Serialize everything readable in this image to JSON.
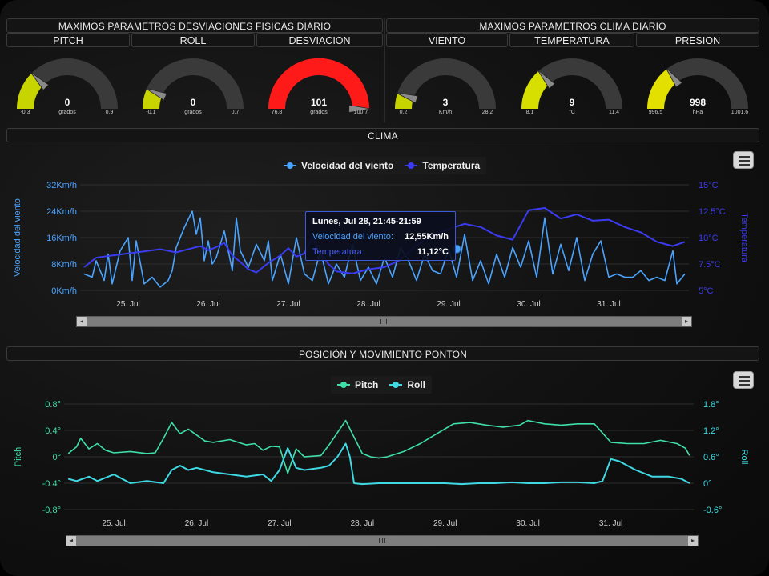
{
  "header": {
    "left_title": "MAXIMOS PARAMETROS DESVIACIONES FISICAS DIARIO",
    "right_title": "MAXIMOS PARAMETROS CLIMA DIARIO"
  },
  "gauges": [
    {
      "id": "pitch",
      "label": "PITCH",
      "value": "0",
      "unit": "grados",
      "min": "-0.3",
      "max": "0.9",
      "fill": 0.25,
      "color": "#c8d400"
    },
    {
      "id": "roll",
      "label": "ROLL",
      "value": "0",
      "unit": "grados",
      "min": "-0.1",
      "max": "0.7",
      "fill": 0.13,
      "color": "#c8d400"
    },
    {
      "id": "desviacion",
      "label": "DESVIACION",
      "value": "101",
      "unit": "grados",
      "min": "76.8",
      "max": "100.7",
      "fill": 1.0,
      "color": "#ff1a1a"
    },
    {
      "id": "viento",
      "label": "VIENTO",
      "value": "3",
      "unit": "Km/h",
      "min": "0.2",
      "max": "28.2",
      "fill": 0.1,
      "color": "#c8d400"
    },
    {
      "id": "temperatura",
      "label": "TEMPERATURA",
      "value": "9",
      "unit": "°C",
      "min": "8.1",
      "max": "11.4",
      "fill": 0.27,
      "color": "#d6df00"
    },
    {
      "id": "presion",
      "label": "PRESION",
      "value": "998",
      "unit": "hPa",
      "min": "996.5",
      "max": "1001.6",
      "fill": 0.29,
      "color": "#e3e000"
    }
  ],
  "clima": {
    "title": "CLIMA",
    "legend": [
      {
        "name": "Velocidad del viento",
        "color": "#4aa3ff"
      },
      {
        "name": "Temperatura",
        "color": "#3b3bf2"
      }
    ],
    "tooltip": {
      "header": "Lunes, Jul 28, 21:45-21:59",
      "row1_label": "Velocidad del viento:",
      "row1_value": "12,55Km/h",
      "row2_label": "Temperatura:",
      "row2_value": "11,12°C"
    },
    "menu_icon": "hamburger-icon"
  },
  "ponton": {
    "title": "POSICIÓN Y MOVIMIENTO PONTON",
    "legend": [
      {
        "name": "Pitch",
        "color": "#3ee0a8"
      },
      {
        "name": "Roll",
        "color": "#3fd9e4"
      }
    ],
    "menu_icon": "hamburger-icon"
  },
  "chart_data": [
    {
      "type": "line",
      "title": "CLIMA",
      "xlabel": "",
      "x_ticks": [
        "25. Jul",
        "26. Jul",
        "27. Jul",
        "28. Jul",
        "29. Jul",
        "30. Jul",
        "31. Jul"
      ],
      "y_left": {
        "label": "Velocidad del viento",
        "ticks": [
          "0Km/h",
          "8Km/h",
          "16Km/h",
          "24Km/h",
          "32Km/h"
        ],
        "range": [
          0,
          32
        ]
      },
      "y_right": {
        "label": "Temperatura",
        "ticks": [
          "5°C",
          "7.5°C",
          "10°C",
          "12.5°C",
          "15°C"
        ],
        "range": [
          5,
          15
        ]
      },
      "x_range": [
        -0.6,
        7.0
      ],
      "series": [
        {
          "name": "Velocidad del viento",
          "axis": "left",
          "color": "#4aa3ff",
          "x": [
            -0.55,
            -0.45,
            -0.4,
            -0.3,
            -0.25,
            -0.2,
            -0.1,
            0.0,
            0.05,
            0.1,
            0.2,
            0.3,
            0.4,
            0.5,
            0.55,
            0.6,
            0.7,
            0.8,
            0.85,
            0.9,
            0.95,
            1.0,
            1.05,
            1.1,
            1.2,
            1.3,
            1.35,
            1.4,
            1.5,
            1.6,
            1.7,
            1.75,
            1.8,
            1.9,
            2.0,
            2.1,
            2.2,
            2.3,
            2.4,
            2.5,
            2.6,
            2.7,
            2.8,
            2.9,
            3.0,
            3.1,
            3.2,
            3.3,
            3.4,
            3.5,
            3.6,
            3.7,
            3.8,
            3.9,
            4.0,
            4.1,
            4.2,
            4.3,
            4.4,
            4.5,
            4.6,
            4.7,
            4.8,
            4.9,
            5.0,
            5.1,
            5.2,
            5.3,
            5.4,
            5.5,
            5.6,
            5.7,
            5.8,
            5.9,
            6.0,
            6.1,
            6.2,
            6.3,
            6.4,
            6.5,
            6.6,
            6.7,
            6.8,
            6.85,
            6.95
          ],
          "values": [
            5,
            4,
            9,
            3,
            11,
            2,
            12,
            16,
            3,
            15,
            2,
            4,
            1,
            3,
            6,
            13,
            19,
            24,
            17,
            22,
            9,
            15,
            8,
            10,
            18,
            6,
            22,
            12,
            7,
            14,
            9,
            15,
            3,
            11,
            2,
            16,
            5,
            3,
            12,
            2,
            8,
            4,
            14,
            3,
            7,
            2,
            10,
            4,
            13,
            9,
            3,
            11,
            6,
            5,
            12.5,
            4,
            17,
            3,
            9,
            2,
            11,
            4,
            13,
            7,
            15,
            4,
            22,
            5,
            14,
            6,
            16,
            3,
            11,
            15,
            4,
            5,
            4,
            4,
            6,
            3,
            4,
            3,
            12,
            2,
            5
          ]
        },
        {
          "name": "Temperatura",
          "axis": "right",
          "color": "#3b3bf2",
          "x": [
            -0.55,
            -0.4,
            -0.2,
            0.0,
            0.2,
            0.4,
            0.6,
            0.8,
            0.9,
            1.0,
            1.1,
            1.2,
            1.3,
            1.4,
            1.5,
            1.6,
            1.75,
            1.9,
            2.0,
            2.1,
            2.2,
            2.3,
            2.4,
            2.5,
            2.6,
            2.8,
            3.0,
            3.2,
            3.4,
            3.5,
            3.6,
            3.8,
            4.0,
            4.2,
            4.4,
            4.6,
            4.8,
            5.0,
            5.2,
            5.4,
            5.6,
            5.8,
            6.0,
            6.2,
            6.4,
            6.6,
            6.8,
            6.95
          ],
          "values": [
            7.2,
            8.1,
            8.3,
            8.5,
            8.7,
            8.9,
            8.6,
            9.0,
            9.2,
            8.8,
            9.1,
            9.5,
            8.3,
            7.7,
            7.0,
            6.7,
            7.6,
            8.3,
            9.0,
            8.2,
            8.5,
            10.0,
            8.6,
            7.5,
            6.8,
            6.6,
            7.0,
            7.2,
            7.9,
            8.6,
            9.3,
            10.2,
            10.8,
            11.3,
            11.0,
            10.2,
            9.8,
            12.6,
            12.8,
            11.8,
            12.2,
            11.6,
            11.7,
            11.0,
            10.5,
            9.6,
            9.2,
            9.6
          ]
        }
      ]
    },
    {
      "type": "line",
      "title": "POSICIÓN Y MOVIMIENTO PONTON",
      "xlabel": "",
      "x_ticks": [
        "25. Jul",
        "26. Jul",
        "27. Jul",
        "28. Jul",
        "29. Jul",
        "30. Jul",
        "31. Jul"
      ],
      "y_left": {
        "label": "Pitch",
        "ticks": [
          "-0.8°",
          "-0.4°",
          "0°",
          "0.4°",
          "0.8°"
        ],
        "range": [
          -0.8,
          0.8
        ]
      },
      "y_right": {
        "label": "Roll",
        "ticks": [
          "-0.6°",
          "0°",
          "0.6°",
          "1.2°",
          "1.8°"
        ],
        "range": [
          -0.6,
          1.8
        ]
      },
      "x_range": [
        -0.6,
        7.0
      ],
      "series": [
        {
          "name": "Pitch",
          "axis": "left",
          "color": "#3ee0a8",
          "x": [
            -0.55,
            -0.45,
            -0.4,
            -0.3,
            -0.2,
            -0.1,
            0.0,
            0.2,
            0.4,
            0.5,
            0.6,
            0.7,
            0.8,
            0.9,
            1.0,
            1.1,
            1.2,
            1.4,
            1.6,
            1.7,
            1.8,
            1.9,
            2.0,
            2.1,
            2.2,
            2.3,
            2.5,
            2.6,
            2.8,
            3.0,
            3.1,
            3.2,
            3.3,
            3.5,
            3.7,
            3.9,
            4.1,
            4.3,
            4.5,
            4.7,
            4.9,
            5.0,
            5.2,
            5.4,
            5.6,
            5.8,
            6.0,
            6.2,
            6.4,
            6.6,
            6.8,
            6.9,
            6.95
          ],
          "values": [
            0.05,
            0.15,
            0.28,
            0.12,
            0.2,
            0.1,
            0.06,
            0.08,
            0.05,
            0.06,
            0.28,
            0.52,
            0.35,
            0.42,
            0.33,
            0.24,
            0.22,
            0.26,
            0.18,
            0.2,
            0.1,
            0.16,
            0.15,
            -0.25,
            0.12,
            0.0,
            0.02,
            0.18,
            0.55,
            0.05,
            0.0,
            -0.02,
            0.0,
            0.08,
            0.2,
            0.35,
            0.5,
            0.52,
            0.48,
            0.45,
            0.48,
            0.55,
            0.5,
            0.48,
            0.5,
            0.5,
            0.22,
            0.2,
            0.2,
            0.25,
            0.2,
            0.13,
            0.02
          ]
        },
        {
          "name": "Roll",
          "axis": "right",
          "color": "#3fd9e4",
          "x": [
            -0.55,
            -0.45,
            -0.3,
            -0.2,
            0.0,
            0.2,
            0.4,
            0.6,
            0.7,
            0.8,
            0.9,
            1.0,
            1.1,
            1.2,
            1.4,
            1.6,
            1.8,
            1.9,
            2.0,
            2.1,
            2.2,
            2.3,
            2.5,
            2.6,
            2.7,
            2.8,
            2.85,
            2.9,
            3.0,
            3.2,
            3.4,
            3.6,
            3.8,
            4.0,
            4.2,
            4.4,
            4.6,
            4.8,
            5.0,
            5.2,
            5.4,
            5.6,
            5.8,
            5.9,
            6.0,
            6.1,
            6.3,
            6.5,
            6.7,
            6.85,
            6.95
          ],
          "values": [
            0.1,
            0.05,
            0.15,
            0.05,
            0.2,
            0.0,
            0.05,
            0.0,
            0.3,
            0.4,
            0.3,
            0.35,
            0.3,
            0.25,
            0.2,
            0.15,
            0.2,
            0.05,
            0.3,
            0.8,
            0.35,
            0.3,
            0.35,
            0.4,
            0.6,
            0.9,
            0.6,
            0.0,
            -0.02,
            0.0,
            0.0,
            0.0,
            0.0,
            0.0,
            -0.02,
            0.0,
            0.0,
            0.02,
            0.0,
            0.0,
            0.02,
            0.02,
            0.0,
            0.05,
            0.55,
            0.5,
            0.3,
            0.15,
            0.15,
            0.1,
            0.0
          ]
        }
      ]
    }
  ]
}
